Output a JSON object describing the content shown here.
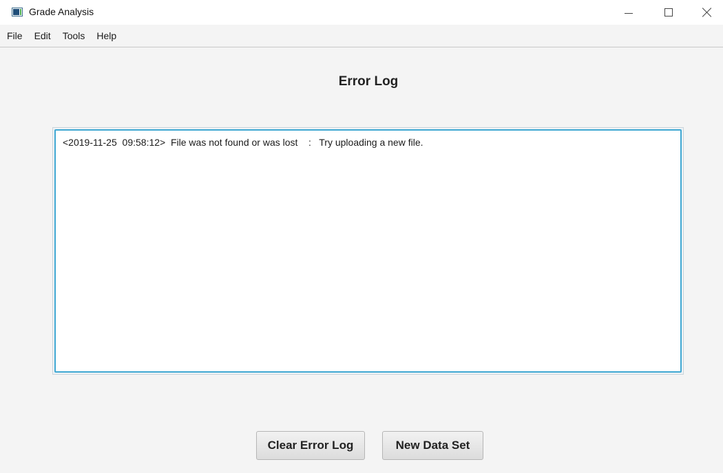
{
  "window": {
    "title": "Grade Analysis",
    "controls": [
      "minimize",
      "maximize",
      "close"
    ]
  },
  "menu": {
    "items": [
      {
        "label": "File"
      },
      {
        "label": "Edit"
      },
      {
        "label": "Tools"
      },
      {
        "label": "Help"
      }
    ]
  },
  "main": {
    "heading": "Error Log",
    "log_text": "<2019-11-25  09:58:12>  File was not found or was lost    :   Try uploading a new file."
  },
  "buttons": {
    "clear_label": "Clear Error Log",
    "new_data_label": "New Data Set"
  },
  "colors": {
    "accent_focus": "#3fa7d2",
    "background": "#f4f4f4"
  },
  "icons": [
    "app-window-icon",
    "minimize-icon",
    "maximize-icon",
    "close-icon"
  ]
}
